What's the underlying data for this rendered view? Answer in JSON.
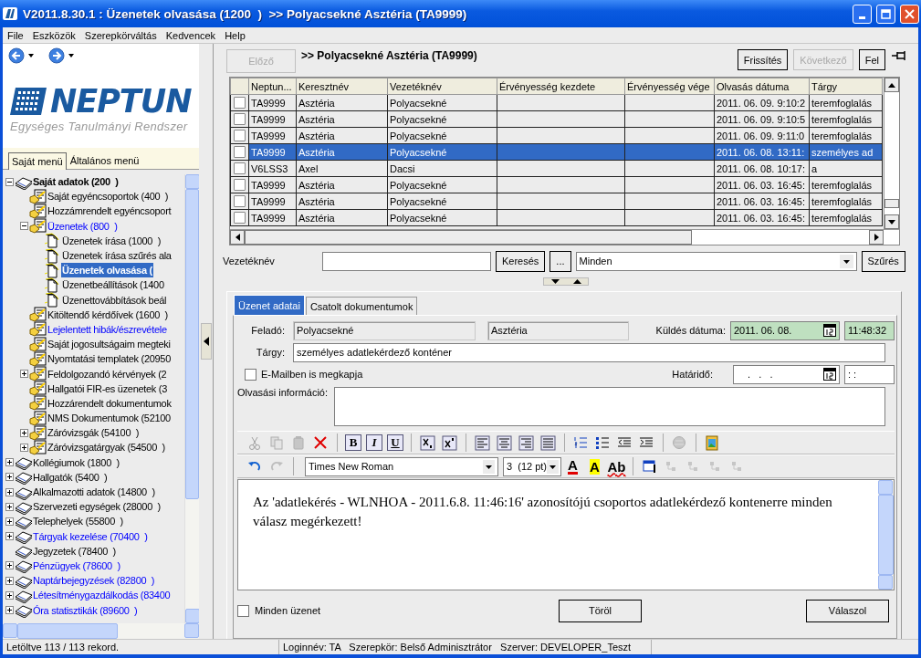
{
  "window": {
    "title": "V2011.8.30.1 : Üzenetek olvasása (1200  )  >> Polyacsekné Asztéria (TA9999)"
  },
  "menu": [
    "File",
    "Eszközök",
    "Szerepkörváltás",
    "Kedvencek",
    "Help"
  ],
  "logo": {
    "name": "NEPTUN",
    "subtitle": "Egységes Tanulmányi Rendszer"
  },
  "sidebar_tabs": [
    {
      "label": "Saját menü",
      "selected": true
    },
    {
      "label": "Általános menü",
      "selected": false
    }
  ],
  "tree": {
    "items": [
      {
        "label": "Saját adatok (200  )",
        "kind": "book",
        "bold": true,
        "expanded": true,
        "selected": false,
        "link": false,
        "children": [
          {
            "label": "Saját egyéncsoportok (400  )",
            "kind": "form",
            "selected": false,
            "link": false
          },
          {
            "label": "Hozzámrendelt egyéncsoport",
            "kind": "form",
            "selected": false,
            "link": false
          },
          {
            "label": "Üzenetek (800  )",
            "kind": "form",
            "expanded": true,
            "selected": false,
            "link": true,
            "children": [
              {
                "label": "Üzenetek írása (1000  )",
                "kind": "page",
                "selected": false,
                "link": false
              },
              {
                "label": "Üzenetek írása szűrés ala",
                "kind": "page",
                "selected": false,
                "link": false
              },
              {
                "label": "Üzenetek olvasása (",
                "kind": "page",
                "selected": true,
                "link": false
              },
              {
                "label": "Üzenetbeállítások (1400",
                "kind": "page",
                "selected": false,
                "link": false
              },
              {
                "label": "Üzenettovábbítások beál",
                "kind": "page",
                "selected": false,
                "link": false
              }
            ]
          },
          {
            "label": "Kitöltendő kérdőívek (1600  )",
            "kind": "form",
            "selected": false,
            "link": false
          },
          {
            "label": "Lejelentett hibák/észrevétele",
            "kind": "form",
            "selected": false,
            "link": true
          },
          {
            "label": "Saját jogosultságaim megteki",
            "kind": "form",
            "selected": false,
            "link": false
          },
          {
            "label": "Nyomtatási templatek (20950",
            "kind": "form",
            "selected": false,
            "link": false
          },
          {
            "label": "Feldolgozandó kérvények (2",
            "kind": "form",
            "expanded": false,
            "selected": false,
            "link": false
          },
          {
            "label": "Hallgatói FIR-es üzenetek (3",
            "kind": "form",
            "selected": false,
            "link": false
          },
          {
            "label": "Hozzárendelt dokumentumok",
            "kind": "form",
            "selected": false,
            "link": false
          },
          {
            "label": "NMS Dokumentumok (52100",
            "kind": "form",
            "selected": false,
            "link": false
          },
          {
            "label": "Záróvizsgák (54100  )",
            "kind": "form",
            "expanded": false,
            "selected": false,
            "link": false
          },
          {
            "label": "Záróvizsgatárgyak (54500  )",
            "kind": "form",
            "expanded": false,
            "selected": false,
            "link": false
          }
        ]
      },
      {
        "label": "Kollégiumok (1800  )",
        "kind": "book",
        "expanded": false,
        "selected": false,
        "link": false
      },
      {
        "label": "Hallgatók (5400  )",
        "kind": "book",
        "expanded": false,
        "selected": false,
        "link": false
      },
      {
        "label": "Alkalmazotti adatok (14800  )",
        "kind": "book",
        "expanded": false,
        "selected": false,
        "link": false
      },
      {
        "label": "Szervezeti egységek (28000  )",
        "kind": "book",
        "expanded": false,
        "selected": false,
        "link": false
      },
      {
        "label": "Telephelyek (55800  )",
        "kind": "book",
        "expanded": false,
        "selected": false,
        "link": false
      },
      {
        "label": "Tárgyak kezelése (70400  )",
        "kind": "book",
        "expanded": false,
        "selected": false,
        "link": true
      },
      {
        "label": "Jegyzetek (78400  )",
        "kind": "book",
        "selected": false,
        "link": false
      },
      {
        "label": "Pénzügyek (78600  )",
        "kind": "book",
        "expanded": false,
        "selected": false,
        "link": true
      },
      {
        "label": "Naptárbejegyzések (82800  )",
        "kind": "book",
        "expanded": false,
        "selected": false,
        "link": true
      },
      {
        "label": "Létesítménygazdálkodás (83400",
        "kind": "book",
        "expanded": false,
        "selected": false,
        "link": true
      },
      {
        "label": "Óra statisztikák (89600  )",
        "kind": "book",
        "expanded": false,
        "selected": false,
        "link": true
      }
    ]
  },
  "toolbar": {
    "prev": {
      "label": "Előző",
      "disabled": true
    },
    "heading": ">> Polyacsekné Asztéria (TA9999)",
    "actions": [
      {
        "label": "Frissítés",
        "disabled": false
      },
      {
        "label": "Következő",
        "disabled": true
      },
      {
        "label": "Fel",
        "disabled": false
      }
    ]
  },
  "grid": {
    "columns": [
      "Neptun...",
      "Keresztnév",
      "Vezetéknév",
      "Érvényesség kezdete",
      "Érvényesség vége",
      "Olvasás dátuma",
      "Tárgy"
    ],
    "rows": [
      {
        "checked": false,
        "selected": false,
        "cells": [
          "TA9999",
          "Asztéria",
          "Polyacsekné",
          "",
          "",
          "2011. 06. 09. 9:10:2",
          "teremfoglalás"
        ]
      },
      {
        "checked": false,
        "selected": false,
        "cells": [
          "TA9999",
          "Asztéria",
          "Polyacsekné",
          "",
          "",
          "2011. 06. 09. 9:10:5",
          "teremfoglalás"
        ]
      },
      {
        "checked": false,
        "selected": false,
        "cells": [
          "TA9999",
          "Asztéria",
          "Polyacsekné",
          "",
          "",
          "2011. 06. 09. 9:11:0",
          "teremfoglalás"
        ]
      },
      {
        "checked": false,
        "selected": true,
        "cells": [
          "TA9999",
          "Asztéria",
          "Polyacsekné",
          "",
          "",
          "2011. 06. 08. 13:11:",
          "személyes ad"
        ]
      },
      {
        "checked": false,
        "selected": false,
        "cells": [
          "V6LSS3",
          "Axel",
          "Dacsi",
          "",
          "",
          "2011. 06. 08. 10:17:",
          "a"
        ]
      },
      {
        "checked": false,
        "selected": false,
        "cells": [
          "TA9999",
          "Asztéria",
          "Polyacsekné",
          "",
          "",
          "2011. 06. 03. 16:45:",
          "teremfoglalás"
        ]
      },
      {
        "checked": false,
        "selected": false,
        "cells": [
          "TA9999",
          "Asztéria",
          "Polyacsekné",
          "",
          "",
          "2011. 06. 03. 16:45:",
          "teremfoglalás"
        ]
      },
      {
        "checked": false,
        "selected": false,
        "cells": [
          "TA9999",
          "Asztéria",
          "Polyacsekné",
          "",
          "",
          "2011. 06. 03. 16:45:",
          "teremfoglalás"
        ]
      }
    ]
  },
  "search": {
    "label": "Vezetéknév",
    "search_button": "Keresés",
    "more_button": "...",
    "filter": "Minden",
    "filter_button": "Szűrés"
  },
  "detail_tabs": [
    {
      "label": "Üzenet adatai",
      "selected": true
    },
    {
      "label": "Csatolt dokumentumok",
      "selected": false
    }
  ],
  "form": {
    "sender_label": "Feladó:",
    "sender_last": "Polyacsekné",
    "sender_first": "Asztéria",
    "sent_label": "Küldés dátuma:",
    "sent_date": "2011. 06. 08.",
    "sent_time": "11:48:32",
    "subject_label": "Tárgy:",
    "subject": "személyes adatlekérdező konténer",
    "email_label": "E-Mailben is megkapja",
    "email_checked": false,
    "deadline_label": "Határidő:",
    "deadline_date": ".   .   .",
    "deadline_time": ": :",
    "read_info_label": "Olvasási információ:"
  },
  "editor": {
    "toolbar1": [
      {
        "kind": "cut",
        "disabled": true
      },
      {
        "kind": "copy",
        "disabled": true
      },
      {
        "kind": "paste",
        "disabled": true
      },
      {
        "kind": "delete",
        "disabled": false
      },
      {
        "kind": "sep"
      },
      {
        "kind": "bold",
        "label": "B",
        "disabled": false
      },
      {
        "kind": "italic",
        "label": "I",
        "disabled": false
      },
      {
        "kind": "underline",
        "label": "U",
        "disabled": false
      },
      {
        "kind": "sep"
      },
      {
        "kind": "subscript",
        "disabled": false
      },
      {
        "kind": "superscript",
        "disabled": false
      },
      {
        "kind": "sep"
      },
      {
        "kind": "align-left",
        "disabled": false
      },
      {
        "kind": "align-center",
        "disabled": false
      },
      {
        "kind": "align-right",
        "disabled": false
      },
      {
        "kind": "justify",
        "disabled": false
      },
      {
        "kind": "sep"
      },
      {
        "kind": "numbered-list",
        "disabled": false
      },
      {
        "kind": "bullet-list",
        "disabled": false
      },
      {
        "kind": "outdent",
        "disabled": false
      },
      {
        "kind": "indent",
        "disabled": false
      },
      {
        "kind": "sep"
      },
      {
        "kind": "globe",
        "disabled": true
      },
      {
        "kind": "sep"
      },
      {
        "kind": "image",
        "disabled": false
      }
    ],
    "toolbar2": [
      {
        "kind": "undo",
        "disabled": false
      },
      {
        "kind": "redo",
        "disabled": true
      },
      {
        "kind": "sep"
      },
      {
        "kind": "font-select",
        "value": "Times New Roman"
      },
      {
        "kind": "size-select",
        "value": "3  (12 pt)"
      },
      {
        "kind": "font-color",
        "label": "A",
        "disabled": false
      },
      {
        "kind": "highlight",
        "label": "A",
        "disabled": false
      },
      {
        "kind": "spell",
        "label": "Ab",
        "disabled": false
      },
      {
        "kind": "sep"
      },
      {
        "kind": "table",
        "disabled": false
      },
      {
        "kind": "table-tool",
        "disabled": true
      },
      {
        "kind": "table-tool",
        "disabled": true
      },
      {
        "kind": "table-tool",
        "disabled": true
      },
      {
        "kind": "table-tool",
        "disabled": true
      }
    ],
    "text": "Az 'adatlekérés - WLNHOA - 2011.6.8. 11:46:16' azonosítójú csoportos adatlekérdező kontenerre minden válasz megérkezett!"
  },
  "bottom": {
    "all_messages_label": "Minden üzenet",
    "all_messages_checked": false,
    "buttons": [
      "Töröl",
      "Válaszol"
    ]
  },
  "status_bar": {
    "records": "Letöltve 113 / 113 rekord.",
    "session": "Loginnév: TA   Szerepkör: Belső Adminisztrátor   Szerver: DEVELOPER_Teszt"
  }
}
